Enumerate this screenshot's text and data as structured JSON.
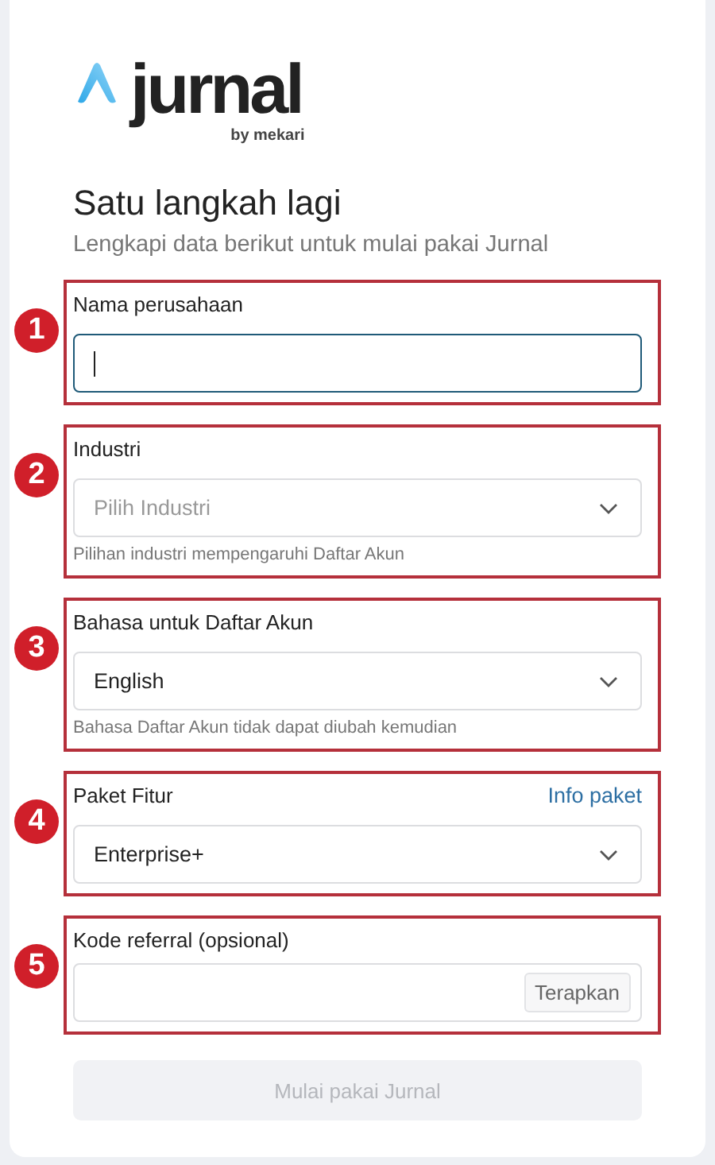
{
  "logo": {
    "wordmark": "jurnal",
    "tagline": "by mekari"
  },
  "heading": "Satu langkah lagi",
  "subheading": "Lengkapi data berikut untuk mulai pakai Jurnal",
  "fields": [
    {
      "number": "1",
      "label": "Nama perusahaan",
      "kind": "text",
      "focused": true
    },
    {
      "number": "2",
      "label": "Industri",
      "kind": "select",
      "placeholder": "Pilih Industri",
      "hint": "Pilihan industri mempengaruhi Daftar Akun"
    },
    {
      "number": "3",
      "label": "Bahasa untuk Daftar Akun",
      "kind": "select",
      "value": "English",
      "hint": "Bahasa Daftar Akun tidak dapat diubah kemudian"
    },
    {
      "number": "4",
      "label": "Paket Fitur",
      "link": "Info paket",
      "kind": "select",
      "value": "Enterprise+"
    },
    {
      "number": "5",
      "label": "Kode referral (opsional)",
      "kind": "code",
      "button": "Terapkan"
    }
  ],
  "submit": {
    "label": "Mulai pakai Jurnal",
    "disabled": true
  }
}
